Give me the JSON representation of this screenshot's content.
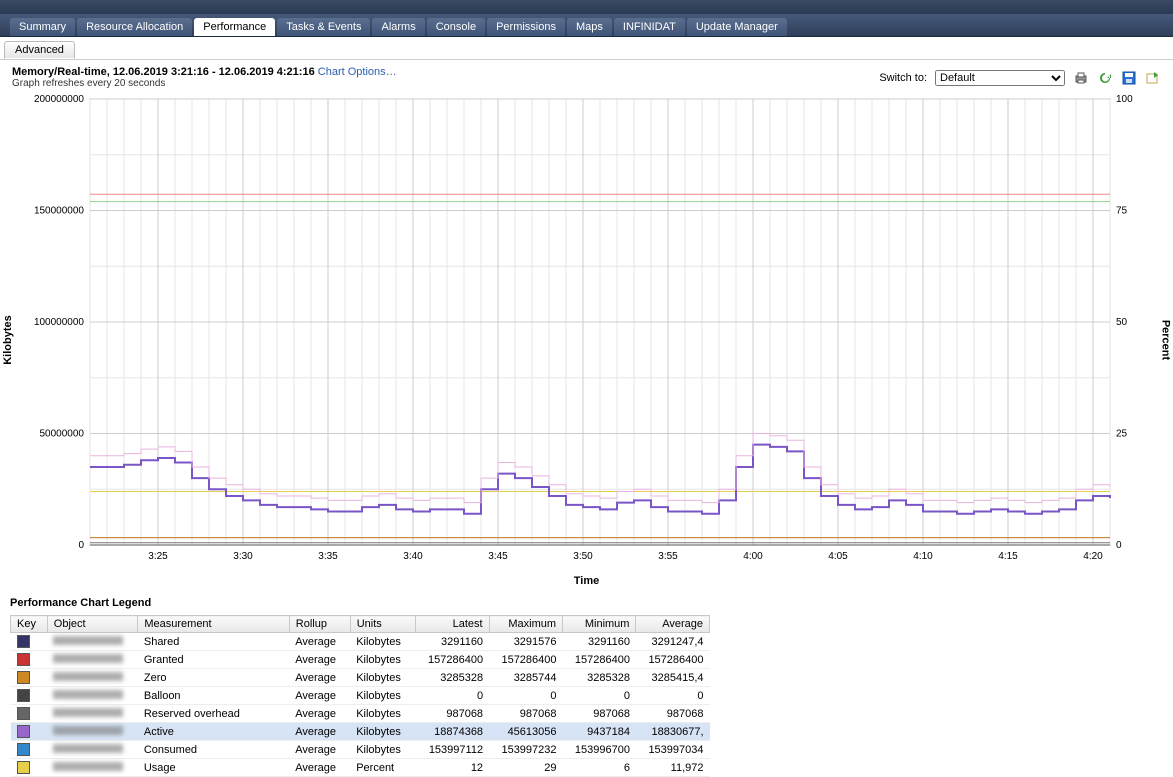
{
  "tabs": {
    "items": [
      "Summary",
      "Resource Allocation",
      "Performance",
      "Tasks & Events",
      "Alarms",
      "Console",
      "Permissions",
      "Maps",
      "INFINIDAT",
      "Update Manager"
    ],
    "active": 2,
    "subtab": "Advanced"
  },
  "header": {
    "title": "Memory/Real-time, 12.06.2019 3:21:16 - 12.06.2019 4:21:16",
    "chart_options": "Chart Options…",
    "refresh_note": "Graph refreshes every 20 seconds",
    "switch_to_label": "Switch to:",
    "switch_to_value": "Default"
  },
  "axes": {
    "left_label": "Kilobytes",
    "right_label": "Percent",
    "bottom_label": "Time",
    "y_left_ticks": [
      "0",
      "50000000",
      "100000000",
      "150000000",
      "200000000"
    ],
    "y_right_ticks": [
      "0",
      "25",
      "50",
      "75",
      "100"
    ],
    "x_ticks": [
      "3:25",
      "3:30",
      "3:35",
      "3:40",
      "3:45",
      "3:50",
      "3:55",
      "4:00",
      "4:05",
      "4:10",
      "4:15",
      "4:20"
    ]
  },
  "chart_data": {
    "type": "line",
    "title": "Memory/Real-time",
    "xlabel": "Time",
    "ylabel": "Kilobytes",
    "ylabel_right": "Percent",
    "ylim_left": [
      0,
      200000000
    ],
    "ylim_right": [
      0,
      100
    ],
    "x": [
      "3:21",
      "3:22",
      "3:23",
      "3:24",
      "3:25",
      "3:26",
      "3:27",
      "3:28",
      "3:29",
      "3:30",
      "3:31",
      "3:32",
      "3:33",
      "3:34",
      "3:35",
      "3:36",
      "3:37",
      "3:38",
      "3:39",
      "3:40",
      "3:41",
      "3:42",
      "3:43",
      "3:44",
      "3:45",
      "3:46",
      "3:47",
      "3:48",
      "3:49",
      "3:50",
      "3:51",
      "3:52",
      "3:53",
      "3:54",
      "3:55",
      "3:56",
      "3:57",
      "3:58",
      "3:59",
      "4:00",
      "4:01",
      "4:02",
      "4:03",
      "4:04",
      "4:05",
      "4:06",
      "4:07",
      "4:08",
      "4:09",
      "4:10",
      "4:11",
      "4:12",
      "4:13",
      "4:14",
      "4:15",
      "4:16",
      "4:17",
      "4:18",
      "4:19",
      "4:20",
      "4:21"
    ],
    "series": [
      {
        "name": "Active",
        "axis": "left",
        "color": "#7a55c7",
        "values": [
          35000000,
          35000000,
          36000000,
          38000000,
          39000000,
          37000000,
          30000000,
          25000000,
          22000000,
          20000000,
          18000000,
          17000000,
          17000000,
          16000000,
          15000000,
          15000000,
          17000000,
          18000000,
          16000000,
          15000000,
          16000000,
          16000000,
          14000000,
          25000000,
          32000000,
          30000000,
          26000000,
          22000000,
          18000000,
          17000000,
          16000000,
          19000000,
          20000000,
          17000000,
          15000000,
          15000000,
          14000000,
          20000000,
          35000000,
          45000000,
          44000000,
          42000000,
          30000000,
          22000000,
          18000000,
          16000000,
          17000000,
          20000000,
          18000000,
          15000000,
          15000000,
          14000000,
          15000000,
          16000000,
          15000000,
          14000000,
          15000000,
          16000000,
          20000000,
          22000000,
          21000000
        ]
      },
      {
        "name": "Active+Overhead",
        "axis": "left",
        "color": "#e8b3e0",
        "values": [
          40000000,
          40000000,
          41000000,
          43000000,
          44000000,
          42000000,
          35000000,
          30000000,
          27000000,
          25000000,
          23000000,
          22000000,
          22000000,
          21000000,
          20000000,
          20000000,
          22000000,
          23000000,
          21000000,
          20000000,
          21000000,
          21000000,
          19000000,
          30000000,
          37000000,
          35000000,
          31000000,
          27000000,
          23000000,
          22000000,
          21000000,
          24000000,
          25000000,
          22000000,
          20000000,
          20000000,
          19000000,
          25000000,
          40000000,
          50000000,
          49000000,
          47000000,
          35000000,
          27000000,
          23000000,
          21000000,
          22000000,
          25000000,
          23000000,
          20000000,
          20000000,
          19000000,
          20000000,
          21000000,
          20000000,
          19000000,
          20000000,
          21000000,
          25000000,
          27000000,
          26000000
        ]
      },
      {
        "name": "Granted",
        "axis": "left",
        "color": "#f28a8a",
        "values_flat": 157286400
      },
      {
        "name": "Consumed",
        "axis": "left",
        "color": "#8fcf91",
        "values_flat": 153997000
      },
      {
        "name": "Shared",
        "axis": "left",
        "color": "#6a6aa3",
        "values_flat": 3291160
      },
      {
        "name": "Zero",
        "axis": "left",
        "color": "#d68b2f",
        "values_flat": 3285328
      },
      {
        "name": "Balloon",
        "axis": "left",
        "color": "#555",
        "values_flat": 0
      },
      {
        "name": "Reserved overhead",
        "axis": "left",
        "color": "#777",
        "values_flat": 987068
      },
      {
        "name": "Usage",
        "axis": "right",
        "color": "#e6cf4a",
        "values_flat": 12
      }
    ]
  },
  "legend": {
    "title": "Performance Chart Legend",
    "headers": {
      "key": "Key",
      "object": "Object",
      "measurement": "Measurement",
      "rollup": "Rollup",
      "units": "Units",
      "latest": "Latest",
      "maximum": "Maximum",
      "minimum": "Minimum",
      "average": "Average"
    },
    "rows": [
      {
        "color": "#333366",
        "measurement": "Shared",
        "rollup": "Average",
        "units": "Kilobytes",
        "latest": "3291160",
        "maximum": "3291576",
        "minimum": "3291160",
        "average": "3291247,4"
      },
      {
        "color": "#cc3333",
        "measurement": "Granted",
        "rollup": "Average",
        "units": "Kilobytes",
        "latest": "157286400",
        "maximum": "157286400",
        "minimum": "157286400",
        "average": "157286400"
      },
      {
        "color": "#cc8822",
        "measurement": "Zero",
        "rollup": "Average",
        "units": "Kilobytes",
        "latest": "3285328",
        "maximum": "3285744",
        "minimum": "3285328",
        "average": "3285415,4"
      },
      {
        "color": "#444444",
        "measurement": "Balloon",
        "rollup": "Average",
        "units": "Kilobytes",
        "latest": "0",
        "maximum": "0",
        "minimum": "0",
        "average": "0"
      },
      {
        "color": "#666666",
        "measurement": "Reserved overhead",
        "rollup": "Average",
        "units": "Kilobytes",
        "latest": "987068",
        "maximum": "987068",
        "minimum": "987068",
        "average": "987068"
      },
      {
        "color": "#9966cc",
        "measurement": "Active",
        "rollup": "Average",
        "units": "Kilobytes",
        "latest": "18874368",
        "maximum": "45613056",
        "minimum": "9437184",
        "average": "18830677,",
        "selected": true
      },
      {
        "color": "#3388cc",
        "measurement": "Consumed",
        "rollup": "Average",
        "units": "Kilobytes",
        "latest": "153997112",
        "maximum": "153997232",
        "minimum": "153996700",
        "average": "153997034"
      },
      {
        "color": "#e6cf4a",
        "measurement": "Usage",
        "rollup": "Average",
        "units": "Percent",
        "latest": "12",
        "maximum": "29",
        "minimum": "6",
        "average": "11,972"
      }
    ]
  }
}
